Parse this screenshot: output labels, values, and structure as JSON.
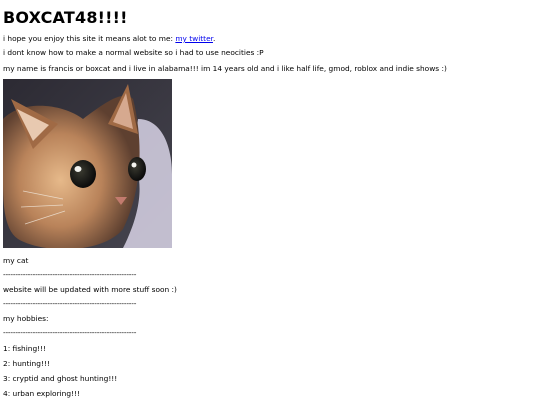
{
  "page": {
    "title": "BOXCAT48!!!!",
    "intro_prefix": "i hope you enjoy this site it means alot to me: ",
    "intro_link": "my twitter",
    "intro_suffix": ".",
    "line_neocities": "i dont know how to make a normal website so i had to use neocities :P",
    "line_about": "my name is francis or boxcat and i live in alabama!!! im 14 years old and i like half life, gmod, roblox and indie shows :)",
    "photo_caption": "my cat",
    "divider": "------------------------------------------------------",
    "update_note": "website will be updated with more stuff soon :)",
    "hobbies_heading": "my hobbies:",
    "hobbies": [
      "1: fishing!!!",
      "2: hunting!!!",
      "3: cryptid and ghost hunting!!!",
      "4: urban exploring!!!"
    ]
  },
  "colors": {
    "background": "#ffffff",
    "text": "#000000",
    "link": "#0000ee"
  }
}
